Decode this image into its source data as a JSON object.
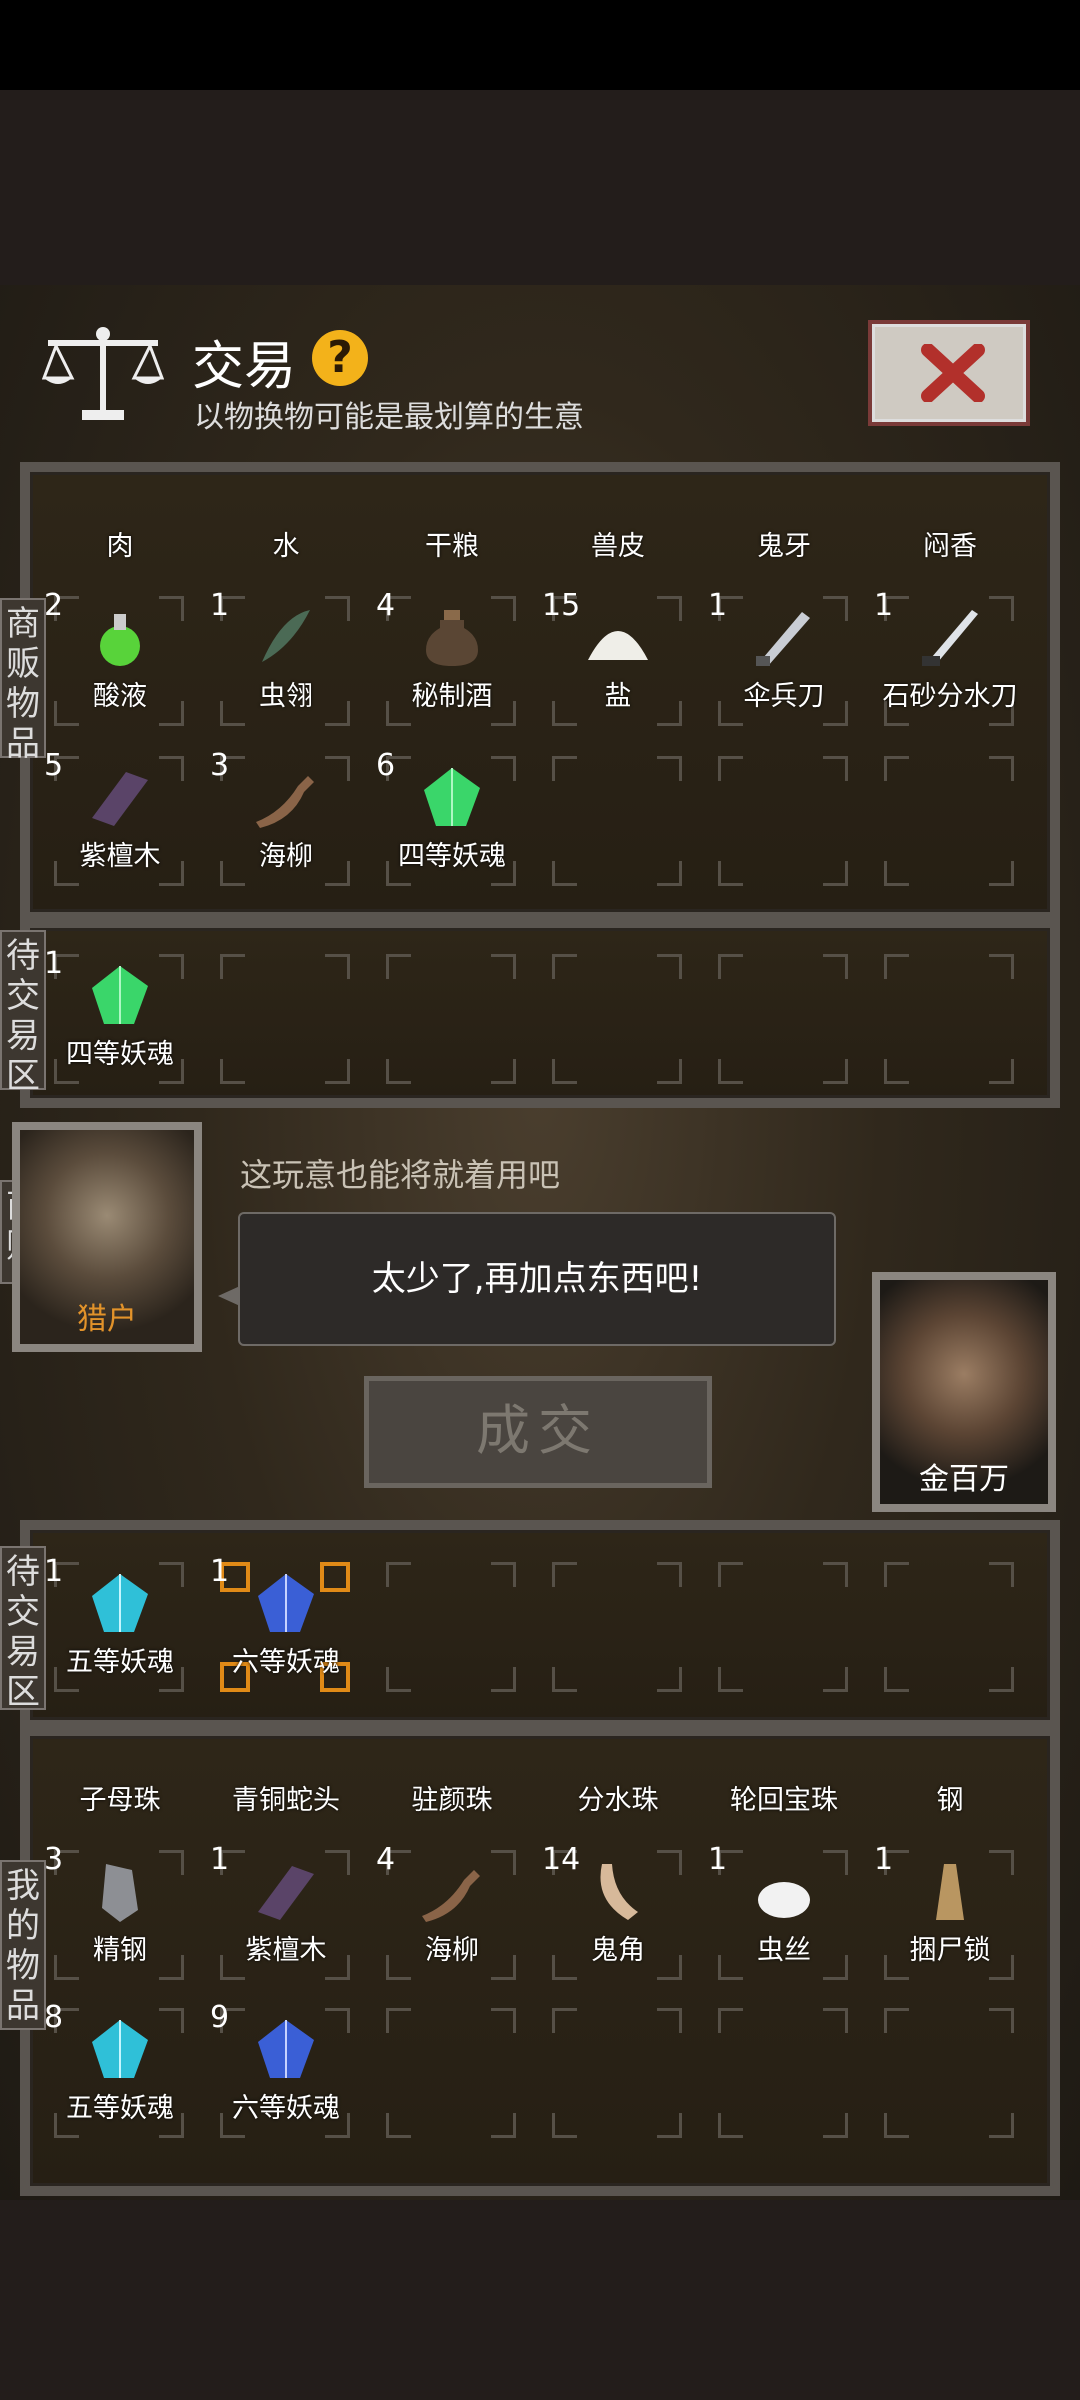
{
  "header": {
    "title": "交易",
    "help_label": "?",
    "subtitle": "以物换物可能是最划算的生意"
  },
  "colors": {
    "accent_orange": "#e08a17",
    "merchant_name": "#e3932a",
    "help": "#f3b21a"
  },
  "merchant_goods": {
    "label": "商贩物品",
    "partial_row": [
      "肉",
      "水",
      "干粮",
      "兽皮",
      "鬼牙",
      "闷香"
    ],
    "items": [
      {
        "qty": "2",
        "name": "酸液",
        "icon": "acid-flask-icon"
      },
      {
        "qty": "1",
        "name": "虫翎",
        "icon": "insect-feather-icon"
      },
      {
        "qty": "4",
        "name": "秘制酒",
        "icon": "wine-jar-icon"
      },
      {
        "qty": "15",
        "name": "盐",
        "icon": "salt-pile-icon"
      },
      {
        "qty": "1",
        "name": "伞兵刀",
        "icon": "knife-icon"
      },
      {
        "qty": "1",
        "name": "石砂分水刀",
        "icon": "blade-icon"
      },
      {
        "qty": "5",
        "name": "紫檀木",
        "icon": "wood-icon"
      },
      {
        "qty": "3",
        "name": "海柳",
        "icon": "branch-icon"
      },
      {
        "qty": "6",
        "name": "四等妖魂",
        "icon": "green-crystal-icon"
      }
    ]
  },
  "merchant_trade_zone": {
    "label": "待交易区",
    "items": [
      {
        "qty": "1",
        "name": "四等妖魂",
        "icon": "green-crystal-icon"
      }
    ]
  },
  "merchant": {
    "label": "商贩",
    "name": "猎户",
    "remark": "这玩意也能将就着用吧",
    "speech": "太少了,再加点东西吧!"
  },
  "player": {
    "name": "金百万"
  },
  "deal_button": "成交",
  "my_trade_zone": {
    "label": "待交易区",
    "items": [
      {
        "qty": "1",
        "name": "五等妖魂",
        "icon": "cyan-crystal-icon"
      },
      {
        "qty": "1",
        "name": "六等妖魂",
        "icon": "blue-crystal-icon"
      }
    ]
  },
  "my_goods": {
    "label": "我的物品",
    "partial_row": [
      "子母珠",
      "青铜蛇头",
      "驻颜珠",
      "分水珠",
      "轮回宝珠",
      "钢"
    ],
    "items": [
      {
        "qty": "3",
        "name": "精钢",
        "icon": "steel-ore-icon"
      },
      {
        "qty": "1",
        "name": "紫檀木",
        "icon": "wood-icon"
      },
      {
        "qty": "4",
        "name": "海柳",
        "icon": "branch-icon"
      },
      {
        "qty": "14",
        "name": "鬼角",
        "icon": "horn-icon"
      },
      {
        "qty": "1",
        "name": "虫丝",
        "icon": "silk-bowl-icon"
      },
      {
        "qty": "1",
        "name": "捆尸锁",
        "icon": "rope-icon"
      },
      {
        "qty": "8",
        "name": "五等妖魂",
        "icon": "cyan-crystal-icon"
      },
      {
        "qty": "9",
        "name": "六等妖魂",
        "icon": "blue-crystal-icon"
      }
    ]
  }
}
